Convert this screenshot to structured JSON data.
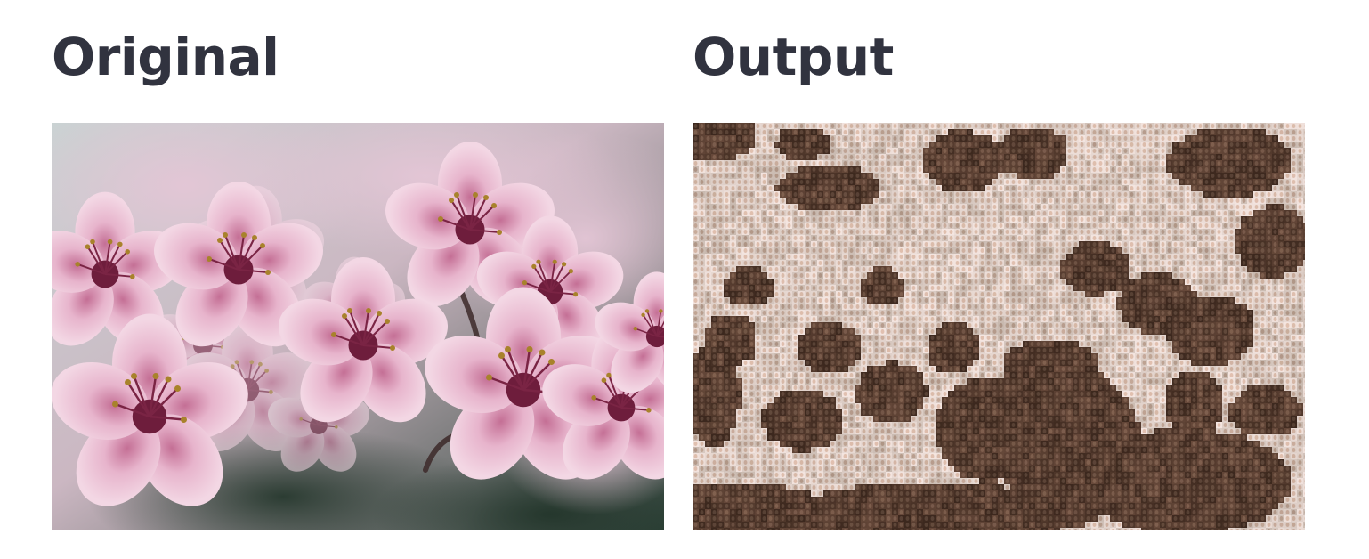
{
  "original": {
    "title": "Original"
  },
  "output": {
    "title": "Output"
  },
  "colors": {
    "title_text": "#31333f",
    "page_background": "#ffffff",
    "blossom_pink": "#e8b7cf",
    "blossom_dark": "#8a2f4f",
    "mosaic_light": "#e6ddd6",
    "mosaic_dark": "#4a3328"
  }
}
